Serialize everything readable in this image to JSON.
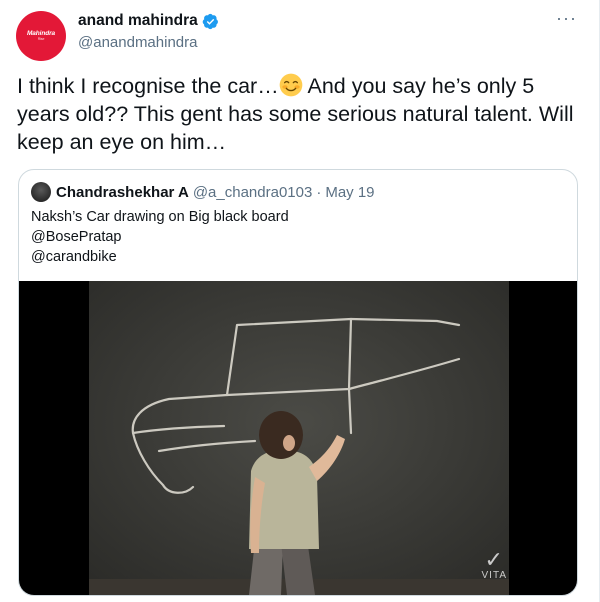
{
  "author": {
    "name": "anand mahindra",
    "handle": "@anandmahindra",
    "avatar_logo_text": "Mahindra",
    "avatar_logo_subtext": "Rise",
    "verified_icon": "verified-badge-icon",
    "brand_color": "#e31837"
  },
  "more_menu_label": "···",
  "tweet": {
    "text_before_emoji": "I think I recognise the car…",
    "emoji": "smiling-face-with-smiling-eyes",
    "text_after_emoji": " And you say he’s only 5 years old?? This gent has some serious natural talent. Will keep an eye on him…"
  },
  "quoted_tweet": {
    "name": "Chandrashekhar A",
    "handle": "@a_chandra0103",
    "separator": "·",
    "date": "May 19",
    "lines": [
      "Naksh’s Car drawing on Big black board",
      "@BosePratap",
      "@carandbike"
    ],
    "media": {
      "type": "video",
      "watermark": "VITA",
      "watermark_icon": "vita-logo-icon"
    }
  },
  "colors": {
    "text_primary": "#0f1419",
    "text_secondary": "#5b7083",
    "verified_blue": "#1d9bf0",
    "border": "#cfd9de"
  }
}
